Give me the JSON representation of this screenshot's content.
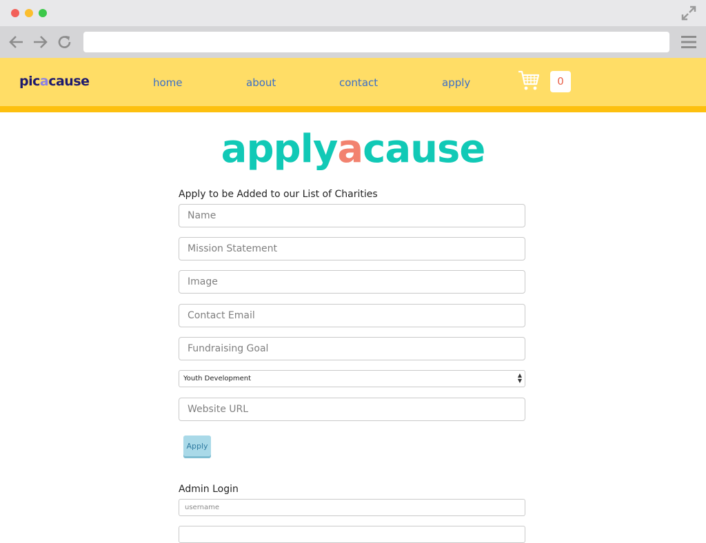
{
  "browser": {
    "address": ""
  },
  "header": {
    "logo_pre": "pic",
    "logo_mid": "a",
    "logo_post": "cause",
    "nav": [
      "home",
      "about",
      "contact",
      "apply"
    ],
    "cart_count": "0"
  },
  "main": {
    "title_pre": "apply",
    "title_mid": "a",
    "title_post": "cause",
    "form_heading": "Apply to be Added to our List of Charities",
    "fields": {
      "name": "Name",
      "mission": "Mission Statement",
      "image": "Image",
      "email": "Contact Email",
      "goal": "Fundraising Goal",
      "website": "Website URL"
    },
    "category_selected": "Youth Development",
    "apply_label": "Apply",
    "admin_heading": "Admin Login",
    "username_placeholder": "username"
  },
  "colors": {
    "header_bg": "#ffdd66",
    "stripe": "#fdc00f",
    "logo_dark": "#1e1a6e",
    "logo_accent": "#8a80e6",
    "title_teal": "#11c9b6",
    "title_accent": "#f2826f",
    "nav_link": "#3b6fc7"
  }
}
